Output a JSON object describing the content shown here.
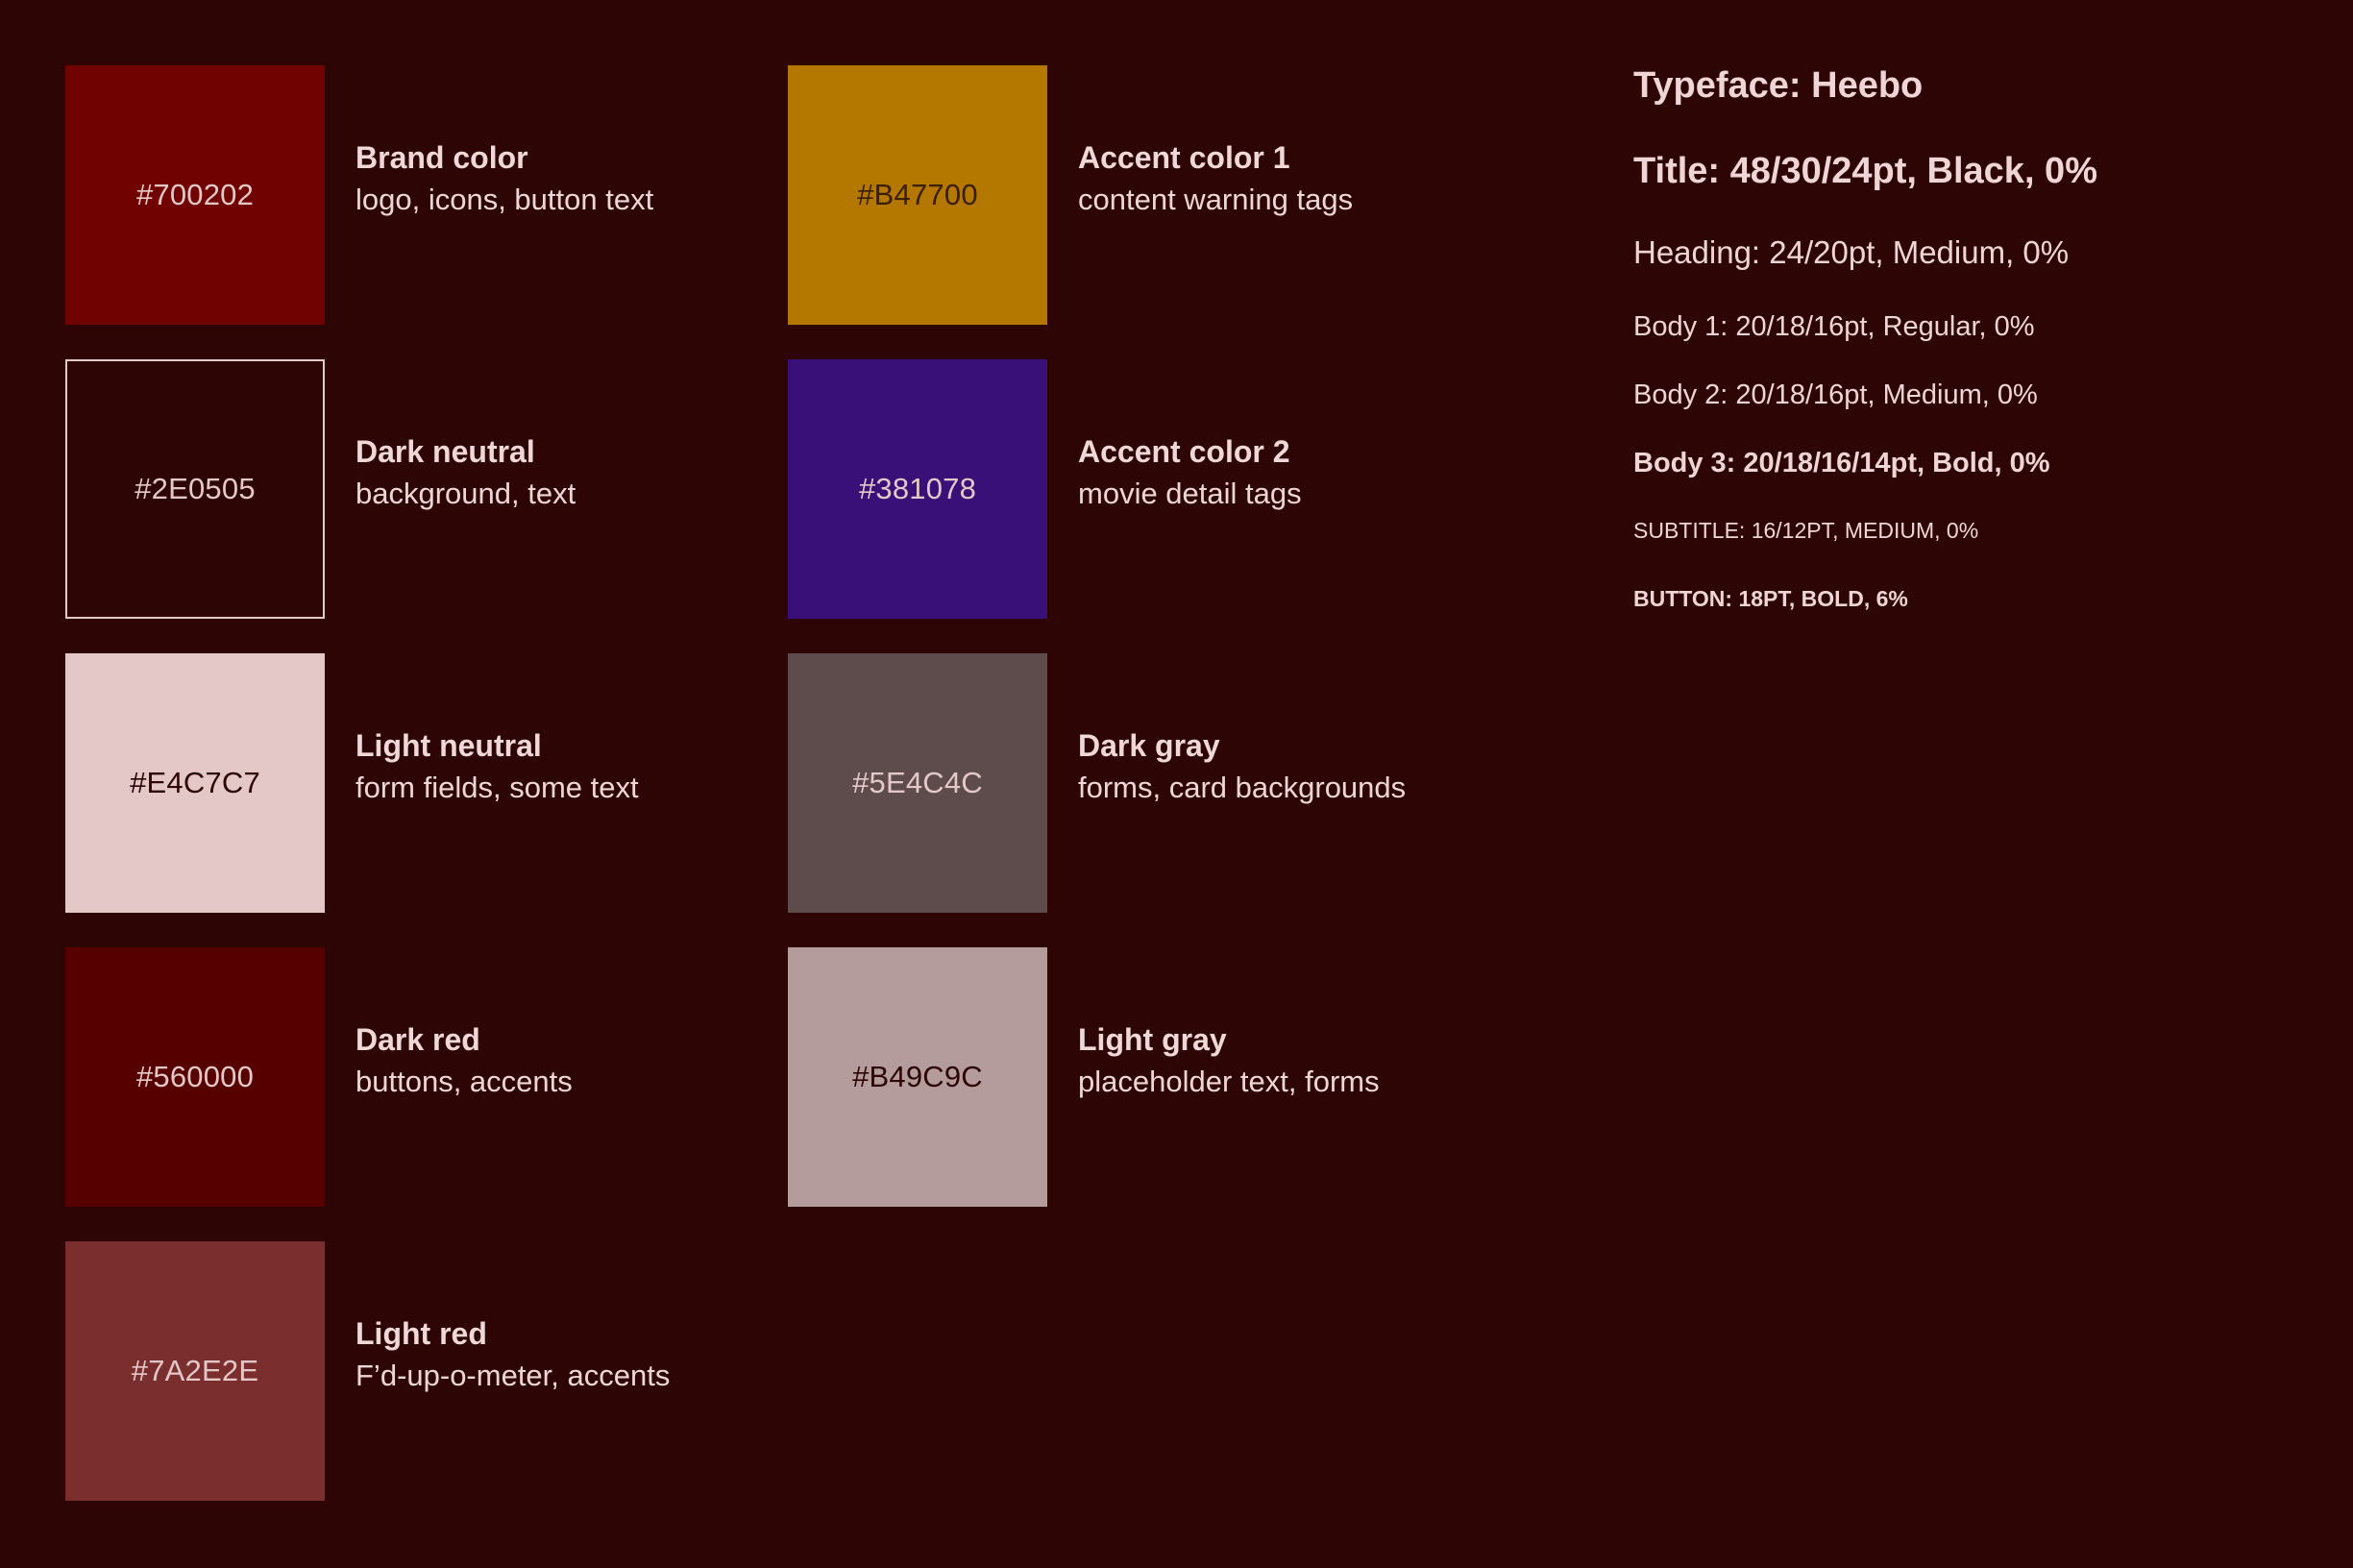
{
  "page": {
    "background_color": "#2E0505"
  },
  "palette": {
    "columns": [
      {
        "id": "left",
        "swatches": [
          {
            "hex": "#700202",
            "hex_label": "#700202",
            "name": "Brand color",
            "usage": "logo, icons, button text",
            "label_color": "#E4C7C7",
            "outlined": false
          },
          {
            "hex": "#2E0505",
            "hex_label": "#2E0505",
            "name": "Dark neutral",
            "usage": "background, text",
            "label_color": "#E4C7C7",
            "outlined": true
          },
          {
            "hex": "#E4C7C7",
            "hex_label": "#E4C7C7",
            "name": "Light neutral",
            "usage": "form fields, some text",
            "label_color": "#2E0505",
            "outlined": false
          },
          {
            "hex": "#560000",
            "hex_label": "#560000",
            "name": "Dark red",
            "usage": "buttons, accents",
            "label_color": "#E4C7C7",
            "outlined": false
          },
          {
            "hex": "#7A2E2E",
            "hex_label": "#7A2E2E",
            "name": "Light red",
            "usage": "F’d-up-o-meter, accents",
            "label_color": "#E4C7C7",
            "outlined": false
          }
        ]
      },
      {
        "id": "middle",
        "swatches": [
          {
            "hex": "#B47700",
            "hex_label": "#B47700",
            "name": "Accent color 1",
            "usage": "content warning tags",
            "label_color": "#3A2000",
            "outlined": false
          },
          {
            "hex": "#381078",
            "hex_label": "#381078",
            "name": "Accent color 2",
            "usage": "movie detail tags",
            "label_color": "#E4C7C7",
            "outlined": false
          },
          {
            "hex": "#5E4C4C",
            "hex_label": "#5E4C4C",
            "name": "Dark gray",
            "usage": "forms, card backgrounds",
            "label_color": "#E4C7C7",
            "outlined": false
          },
          {
            "hex": "#B49C9C",
            "hex_label": "#B49C9C",
            "name": "Light gray",
            "usage": "placeholder text, forms",
            "label_color": "#2E0505",
            "outlined": false
          }
        ]
      }
    ]
  },
  "typography": {
    "typeface": "Typeface: Heebo",
    "title": "Title: 48/30/24pt, Black, 0%",
    "heading": "Heading:  24/20pt, Medium, 0%",
    "body1": "Body 1: 20/18/16pt, Regular, 0%",
    "body2": "Body 2: 20/18/16pt, Medium, 0%",
    "body3": "Body 3: 20/18/16/14pt, Bold, 0%",
    "subtitle": "SUBTITLE: 16/12PT, MEDIUM, 0%",
    "button": "BUTTON: 18PT, BOLD, 6%"
  }
}
